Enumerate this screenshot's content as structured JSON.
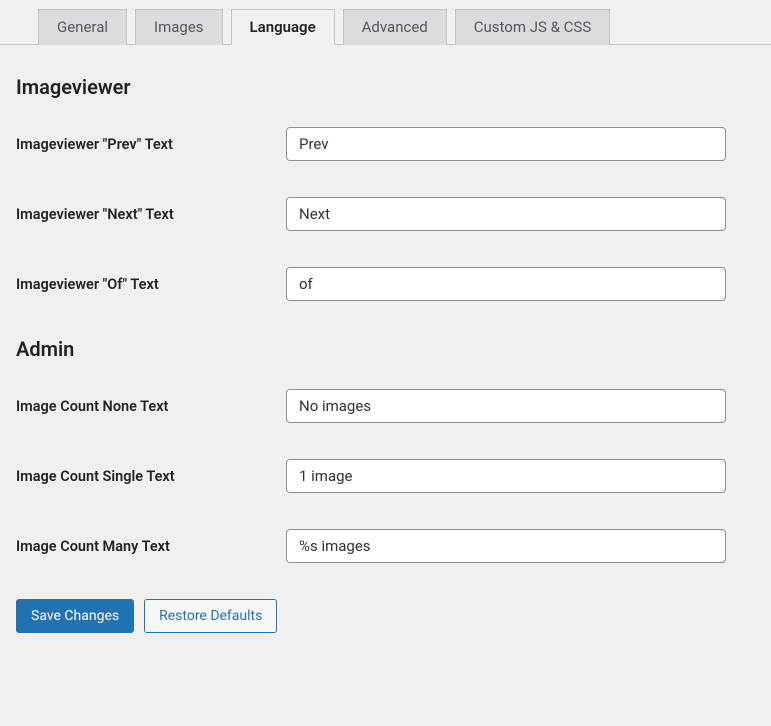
{
  "tabs": {
    "general": "General",
    "images": "Images",
    "language": "Language",
    "advanced": "Advanced",
    "custom": "Custom JS & CSS",
    "active": "language"
  },
  "sections": {
    "imageviewer": {
      "title": "Imageviewer",
      "fields": {
        "prev": {
          "label": "Imageviewer \"Prev\" Text",
          "value": "Prev"
        },
        "next": {
          "label": "Imageviewer \"Next\" Text",
          "value": "Next"
        },
        "of": {
          "label": "Imageviewer \"Of\" Text",
          "value": "of"
        }
      }
    },
    "admin": {
      "title": "Admin",
      "fields": {
        "none": {
          "label": "Image Count None Text",
          "value": "No images"
        },
        "single": {
          "label": "Image Count Single Text",
          "value": "1 image"
        },
        "many": {
          "label": "Image Count Many Text",
          "value": "%s images"
        }
      }
    }
  },
  "buttons": {
    "save": "Save Changes",
    "restore": "Restore Defaults"
  }
}
